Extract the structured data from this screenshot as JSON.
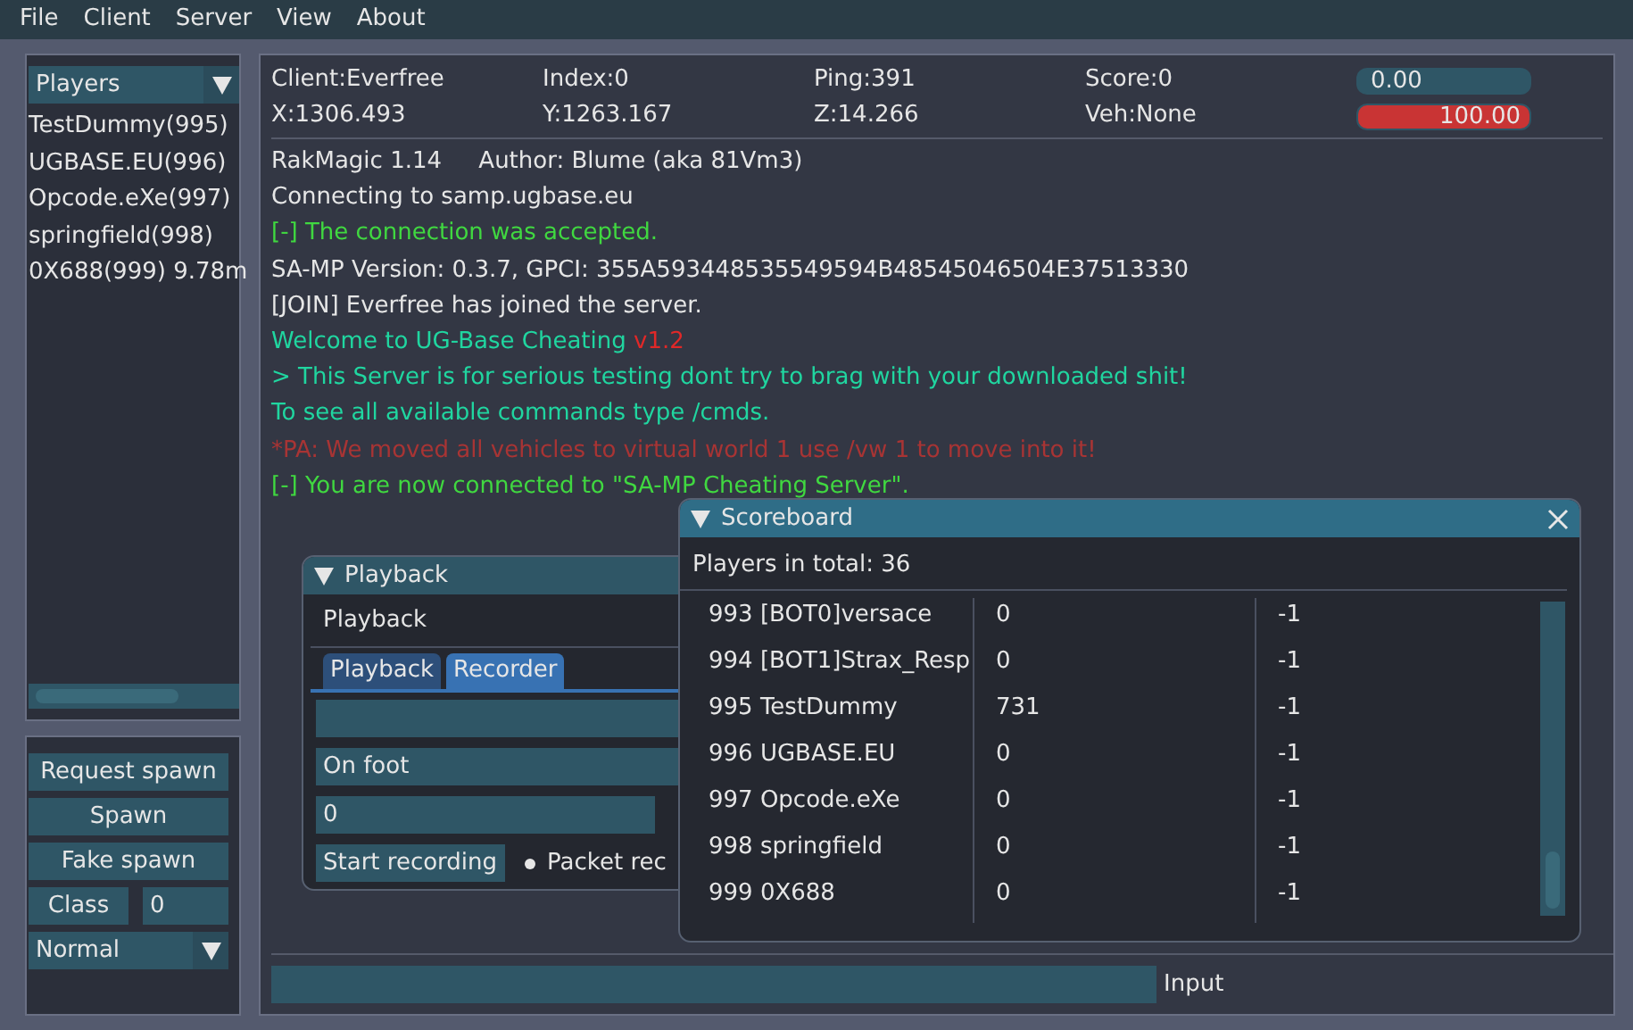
{
  "menu": [
    "File",
    "Client",
    "Server",
    "View",
    "About"
  ],
  "players_panel": {
    "combo": "Players",
    "items": [
      "TestDummy(995)",
      "UGBASE.EU(996)",
      "Opcode.eXe(997)",
      "springfield(998)",
      "0X688(999) 9.78m"
    ]
  },
  "spawn_panel": {
    "buttons": [
      "Request spawn",
      "Spawn",
      "Fake spawn"
    ],
    "class_button": "Class",
    "class_value": "0",
    "mode_combo": "Normal"
  },
  "status": {
    "cells": [
      [
        "Client:Everfree",
        "Index:0",
        "Ping:391",
        "Score:0"
      ],
      [
        "X:1306.493",
        "Y:1263.167",
        "Z:14.266",
        "Veh:None"
      ]
    ],
    "bars": [
      {
        "kind": "armor",
        "level": 0,
        "reading": "0.00"
      },
      {
        "kind": "health",
        "level": 1,
        "reading": "100.00"
      }
    ]
  },
  "chat": [
    [
      {
        "text": "RakMagic 1.14     Author: Blume (aka 81Vm3)",
        "color": "#e6e6e6"
      }
    ],
    [
      {
        "text": "Connecting to samp.ugbase.eu",
        "color": "#e6e6e6"
      }
    ],
    [
      {
        "text": "[-] The connection was accepted.",
        "color": "#40d840"
      }
    ],
    [
      {
        "text": "SA-MP Version: 0.3.7, GPCI: 355A593448535549594B48545046504E37513330",
        "color": "#e6e6e6"
      }
    ],
    [
      {
        "text": "[JOIN] Everfree has joined the server.",
        "color": "#e6e6e6"
      }
    ],
    [
      {
        "text": "Welcome to UG-Base Cheating ",
        "color": "#20d6a0"
      },
      {
        "text": "v1.2",
        "color": "#e02828"
      }
    ],
    [
      {
        "text": "> This Server is for serious testing dont try to brag with your downloaded shit!",
        "color": "#20d6a0"
      }
    ],
    [
      {
        "text": "To see all available commands type /cmds.",
        "color": "#20d6a0"
      }
    ],
    [
      {
        "text": "*PA: We moved all vehicles to virtual world 1 use /vw 1 to move into it!",
        "color": "#a83434"
      }
    ],
    [
      {
        "text": "[-] You are now connected to \"SA-MP Cheating Server\".",
        "color": "#40d840"
      }
    ]
  ],
  "playback_window": {
    "title": "Playback",
    "header": "Playback",
    "tabs": [
      {
        "label": "Playback",
        "selected": false
      },
      {
        "label": "Recorder",
        "selected": true
      }
    ],
    "record_type": "On foot",
    "goal_player": "0",
    "start_button": "Start recording",
    "packet_label": "Packet rec"
  },
  "scoreboard": {
    "title": "Scoreboard",
    "total": "Players in total: 36",
    "rows": [
      [
        "993 [BOT0]versace",
        "0",
        "-1"
      ],
      [
        "994 [BOT1]Strax_Resp",
        "0",
        "-1"
      ],
      [
        "995 TestDummy",
        "731",
        "-1"
      ],
      [
        "996 UGBASE.EU",
        "0",
        "-1"
      ],
      [
        "997 Opcode.eXe",
        "0",
        "-1"
      ],
      [
        "998 springfield",
        "0",
        "-1"
      ],
      [
        "999 0X688",
        "0",
        "-1"
      ]
    ]
  },
  "input": {
    "label": "Input"
  }
}
